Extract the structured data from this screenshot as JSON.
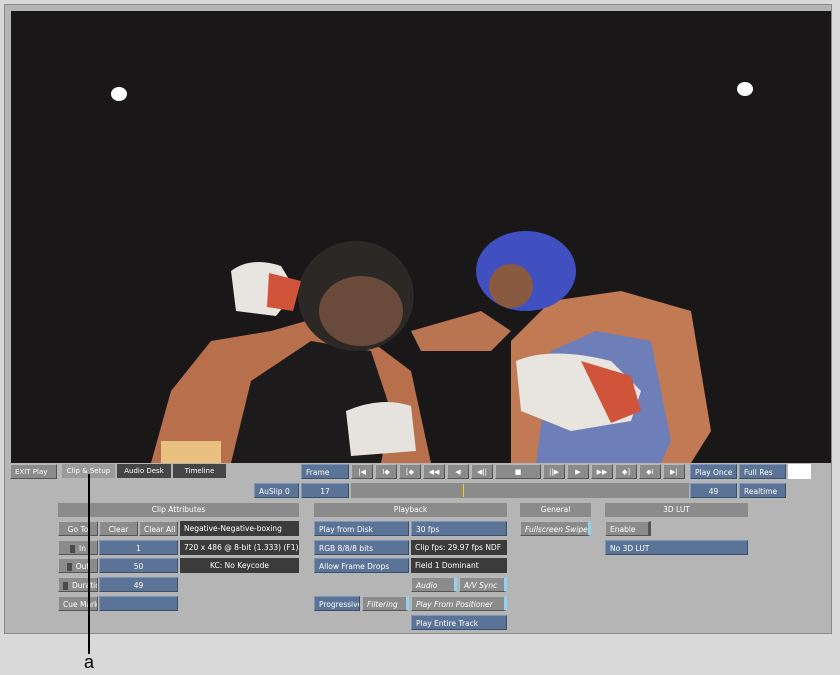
{
  "image_text": {
    "callout": "a"
  },
  "tabs": {
    "exit": "EXIT Play",
    "clip_setup": "Clip & Setup",
    "audio_desk": "Audio Desk",
    "timeline": "Timeline"
  },
  "transport": {
    "frame_label": "Frame",
    "frame_value": "17",
    "auslip": "AuSlip 0",
    "end_value": "49",
    "play_once": "Play Once",
    "full_res": "Full Res",
    "realtime": "Realtime",
    "icons": [
      "go-to-start-icon",
      "mark-in-icon",
      "go-to-in-icon",
      "jog-back-icon",
      "play-reverse-icon",
      "step-back-icon",
      "stop-icon",
      "step-forward-icon",
      "play-icon",
      "jog-forward-icon",
      "go-to-out-icon",
      "mark-out-icon",
      "go-to-end-icon"
    ],
    "glyphs": [
      "|◀",
      "I◆",
      "[◆",
      "◀◀",
      "◀",
      "◀||",
      "■",
      "||▶",
      "▶",
      "▶▶",
      "◆]",
      "◆I",
      "▶|"
    ],
    "scrub_position": 0.33
  },
  "clip_attributes": {
    "header": "Clip Attributes",
    "goto": "Go To",
    "clear": "Clear",
    "clear_all": "Clear All",
    "clip_name": "Negative-Negative-boxing",
    "in_label": "In",
    "in_value": "1",
    "format": "720 x 486 @ 8-bit (1.333) (F1)",
    "out_label": "Out",
    "out_value": "50",
    "keycode": "KC: No Keycode",
    "duration_label": "Duration",
    "duration_value": "49",
    "cue_mark": "Cue Mark"
  },
  "playback": {
    "header": "Playback",
    "play_from_disk": "Play from Disk",
    "fps": "30 fps",
    "rgb": "RGB 8/8/8 bits",
    "clip_fps": "Clip fps: 29.97 fps NDF",
    "allow_drops": "Allow Frame Drops",
    "field": "Field 1 Dominant",
    "audio": "Audio",
    "av_sync": "A/V Sync",
    "progressive": "Progressive",
    "filtering": "Filtering",
    "play_from_positioner": "Play From Positioner",
    "play_entire_track": "Play Entire Track"
  },
  "general": {
    "header": "General",
    "fullscreen_swipe": "Fullscreen Swipe"
  },
  "lut": {
    "header": "3D LUT",
    "enable": "Enable",
    "no_lut": "No 3D LUT"
  },
  "colors": {
    "panel": "#b5b5b5",
    "button_blue": "#5b7396",
    "button_grey": "#8b8b8b",
    "button_dark": "#3b3b3b",
    "accent_cyan": "#8fd3f0",
    "marker": "#ffd400"
  }
}
